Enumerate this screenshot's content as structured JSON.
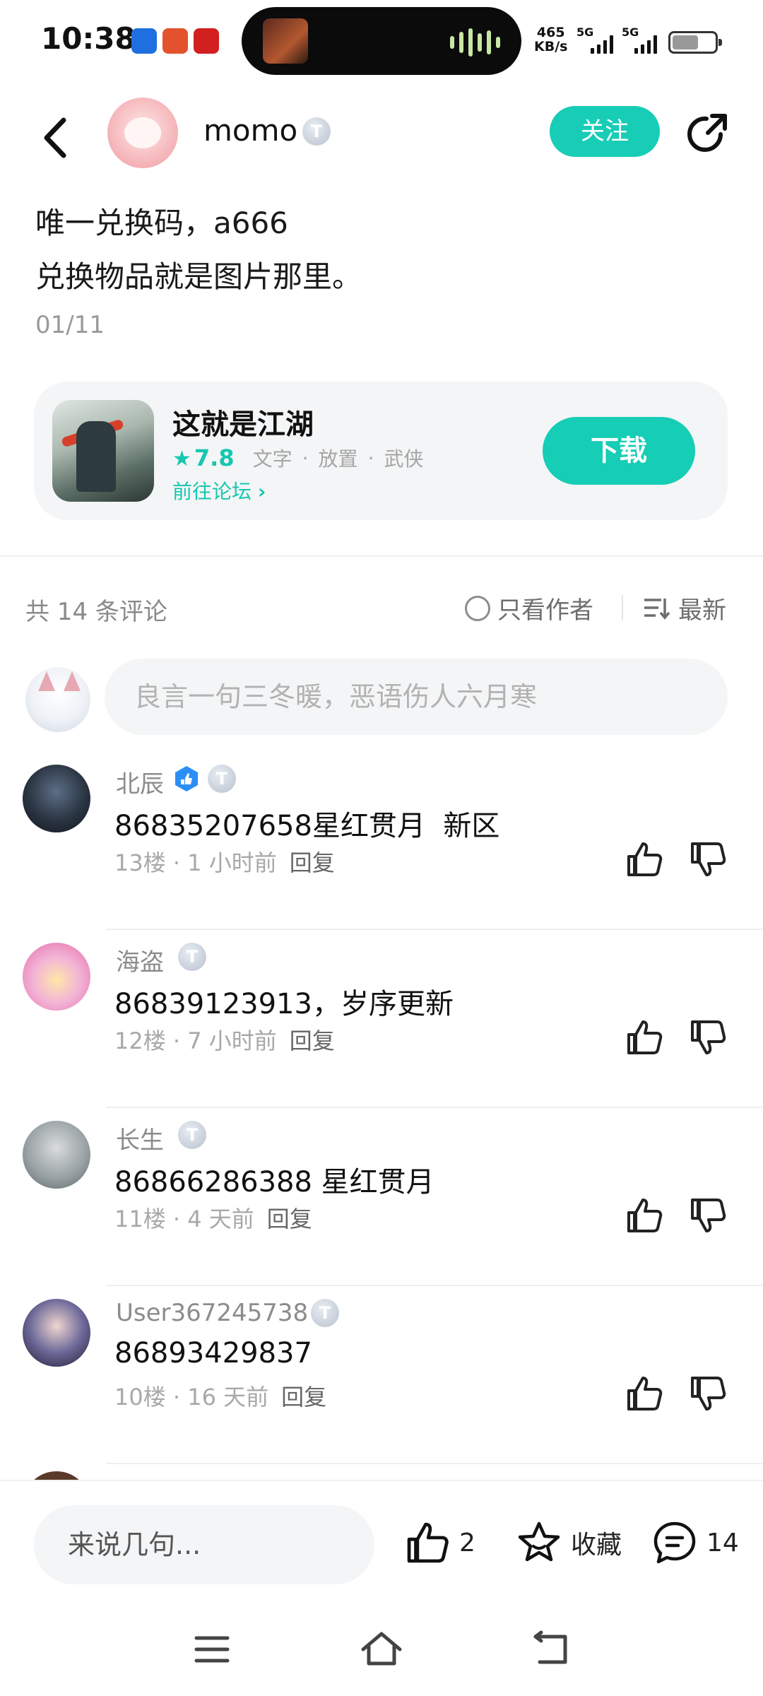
{
  "status_bar": {
    "time": "10:38",
    "net_speed_value": "465",
    "net_speed_unit": "KB/s",
    "signal_1": "5G",
    "signal_2": "5G"
  },
  "header": {
    "back_icon": "chevron-left-icon",
    "username": "momo",
    "level": "T",
    "follow_label": "关注",
    "share_icon": "share-arrow-icon"
  },
  "post": {
    "lines": [
      "唯一兑换码，a666",
      "兑换物品就是图片那里。"
    ],
    "date": "01/11"
  },
  "game_card": {
    "name": "这就是江湖",
    "rating": "7.8",
    "tags": [
      "文字",
      "放置",
      "武侠"
    ],
    "forum_link": "前往论坛",
    "download_label": "下载"
  },
  "comments_header": {
    "count_label": "共 14 条评论",
    "author_only_label": "只看作者",
    "sort_label": "最新"
  },
  "comment_input": {
    "placeholder": "良言一句三冬暖，恶语伤人六月寒"
  },
  "comments": [
    {
      "name": "北辰",
      "verified": true,
      "level": "T",
      "text": "86835207658星红贯月  新区",
      "floor": "13楼",
      "time": "1 小时前",
      "reply": "回复"
    },
    {
      "name": "海盗",
      "verified": false,
      "level": "T",
      "text": "86839123913，岁序更新",
      "floor": "12楼",
      "time": "7 小时前",
      "reply": "回复"
    },
    {
      "name": "长生",
      "verified": false,
      "level": "T",
      "text": "86866286388 星红贯月",
      "floor": "11楼",
      "time": "4 天前",
      "reply": "回复"
    },
    {
      "name": "User367245738",
      "verified": false,
      "level": "T",
      "text": "86893429837",
      "floor": "10楼",
      "time": "16 天前",
      "reply": "回复"
    }
  ],
  "bottom_bar": {
    "input_placeholder": "来说几句...",
    "like_count": "2",
    "favorite_label": "收藏",
    "comment_count": "14"
  },
  "colors": {
    "accent": "#18cdb6",
    "text_primary": "#111111",
    "text_secondary": "#8c8c8c",
    "card_bg": "#f4f5f6"
  }
}
